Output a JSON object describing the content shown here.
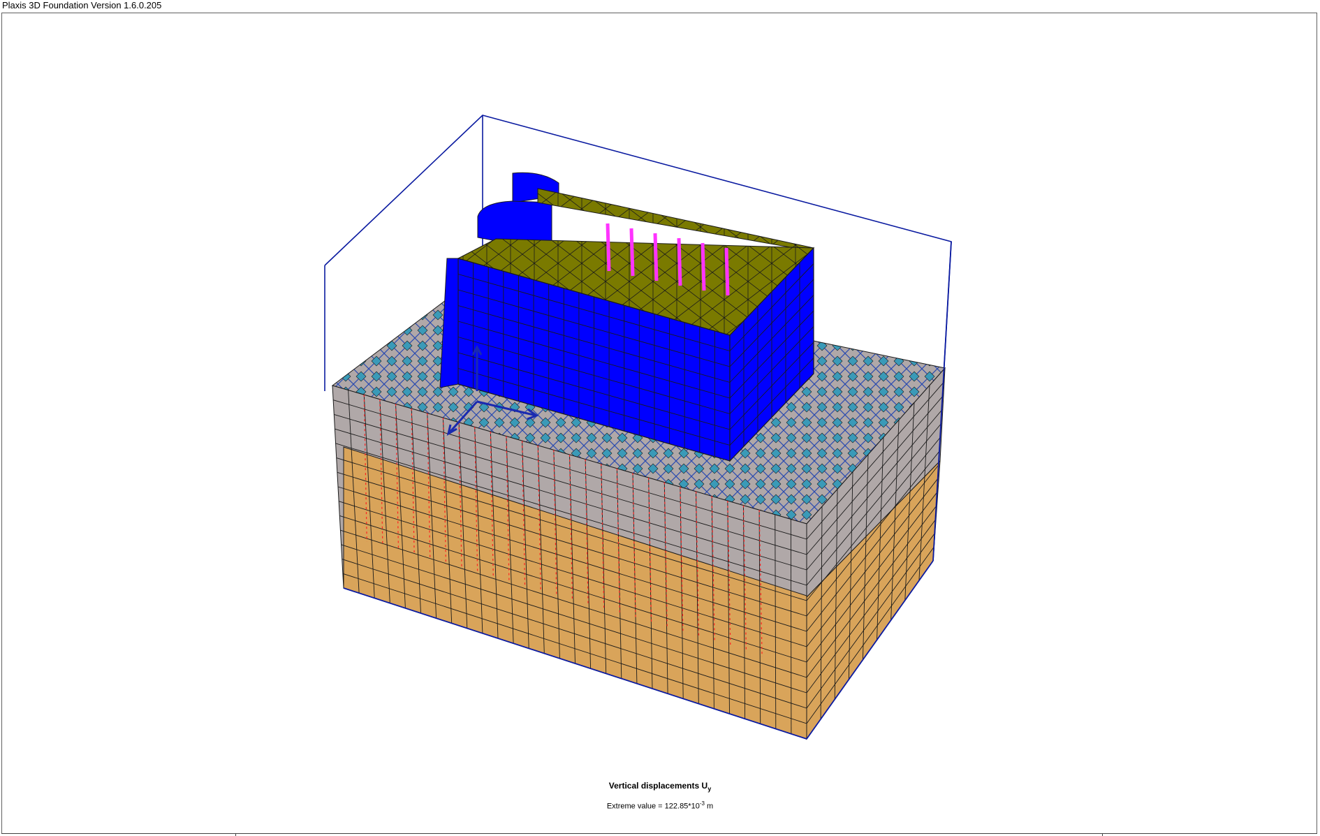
{
  "window": {
    "title": "Plaxis 3D Foundation Version 1.6.0.205"
  },
  "output": {
    "quantity_title": "Vertical displacements U",
    "quantity_subscript": "y",
    "extreme_label": "Extreme value = 122.85*10",
    "extreme_exponent": "-3",
    "extreme_unit": " m"
  },
  "colors": {
    "structure": "#0000ff",
    "slab": "#7a7a00",
    "soil_top": "#b0a8a8",
    "soil_bottom": "#d9a45a",
    "mesh_edge": "#1a1a1a",
    "bounding_box": "#0a1aa0",
    "pile": "#ff33ff",
    "displacement_vector": "#ff2020"
  },
  "icons": [
    "axis-triad-icon"
  ]
}
